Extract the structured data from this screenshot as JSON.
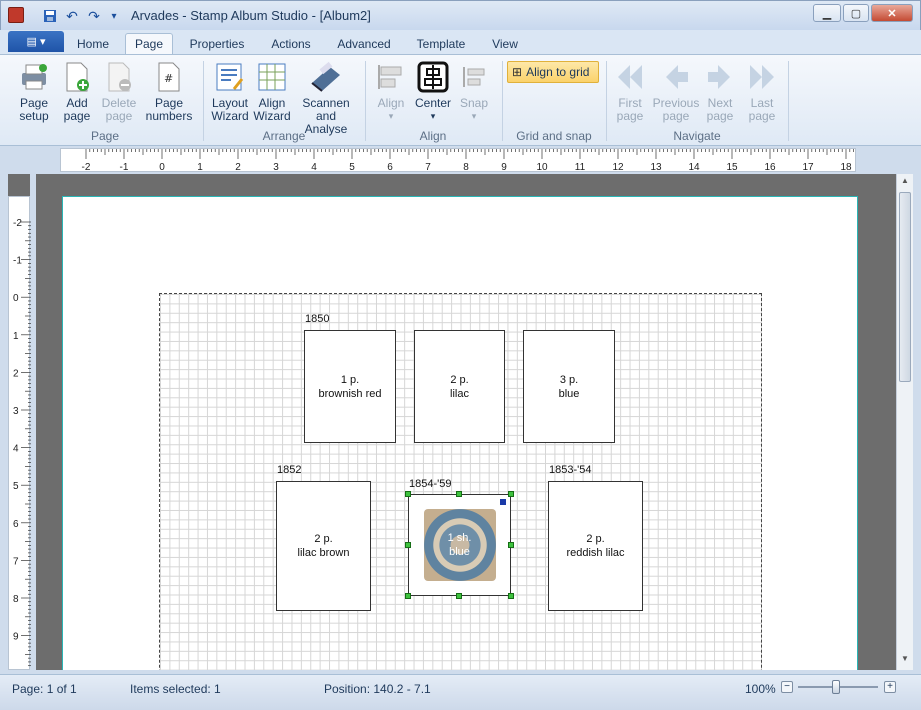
{
  "window": {
    "title": "Arvades - Stamp Album Studio - [Album2]"
  },
  "tabs": [
    {
      "label": "Home"
    },
    {
      "label": "Page"
    },
    {
      "label": "Properties"
    },
    {
      "label": "Actions"
    },
    {
      "label": "Advanced"
    },
    {
      "label": "Template"
    },
    {
      "label": "View"
    }
  ],
  "ribbon": {
    "page_group": {
      "label": "Page",
      "setup": "Page setup",
      "add": "Add page",
      "delete": "Delete page",
      "numbers": "Page numbers"
    },
    "arrange_group": {
      "label": "Arrange",
      "layout": "Layout Wizard",
      "align_wizard": "Align Wizard",
      "scan": "Scannen and Analyse"
    },
    "align_group": {
      "label": "Align",
      "align": "Align",
      "center": "Center",
      "snap": "Snap"
    },
    "grid_group": {
      "label": "Grid and snap",
      "align_grid": "Align to grid"
    },
    "navigate_group": {
      "label": "Navigate",
      "first": "First page",
      "previous": "Previous page",
      "next": "Next page",
      "last": "Last page"
    }
  },
  "hruler": {
    "labels": [
      "-2",
      "-1",
      "0",
      "1",
      "2",
      "3",
      "4",
      "5",
      "6",
      "7",
      "8",
      "9",
      "10",
      "11",
      "12",
      "13",
      "14",
      "15",
      "16",
      "17",
      "18"
    ]
  },
  "vruler": {
    "labels": [
      "-2",
      "-1",
      "0",
      "1",
      "2",
      "3",
      "4",
      "5",
      "6",
      "7",
      "8",
      "9"
    ]
  },
  "album": {
    "years": [
      "1850",
      "1852",
      "1854-'59",
      "1853-'54"
    ],
    "stamps": [
      {
        "value": "1 p.",
        "color": "brownish red"
      },
      {
        "value": "2 p.",
        "color": "lilac"
      },
      {
        "value": "3 p.",
        "color": "blue"
      },
      {
        "value": "2 p.",
        "color": "lilac brown"
      },
      {
        "value": "1 sh.",
        "color": "blue"
      },
      {
        "value": "2 p.",
        "color": "reddish lilac"
      }
    ]
  },
  "status": {
    "page": "Page: 1 of 1",
    "selected": "Items selected: 1",
    "position": "Position: 140.2 - 7.1",
    "zoom": "100%"
  }
}
